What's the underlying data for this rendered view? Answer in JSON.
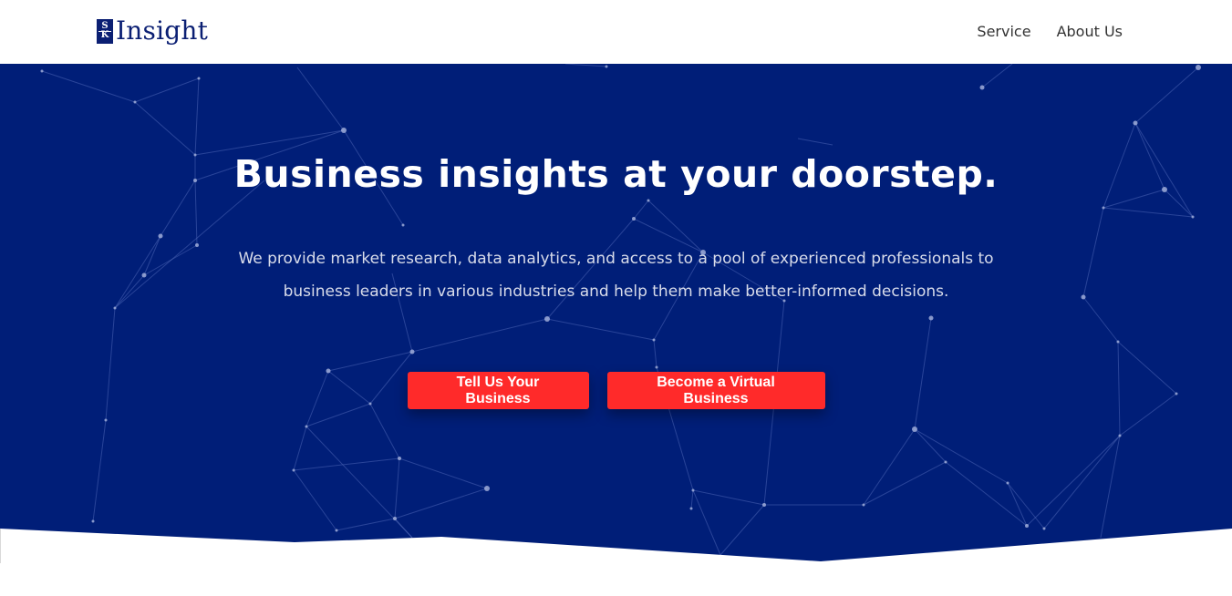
{
  "header": {
    "logo_mark_top": "S",
    "logo_mark_bottom": "K",
    "logo_text": "Insight",
    "nav": [
      "Service",
      "About Us"
    ]
  },
  "hero": {
    "title": "Business insights at your doorstep.",
    "description": "We provide market research, data analytics, and access to a pool of experienced professionals to business leaders in various industries and help them make better-informed decisions.",
    "buttons": [
      "Tell Us Your Business",
      "Become a Virtual Business"
    ]
  },
  "colors": {
    "hero_bg": "#001e78",
    "brand_navy": "#0b1f73",
    "cta_red": "#ff2a2a"
  }
}
